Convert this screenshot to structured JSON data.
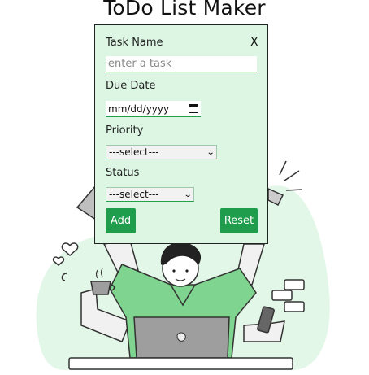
{
  "app": {
    "title": "ToDo List Maker"
  },
  "modal": {
    "close_label": "X",
    "task_name": {
      "label": "Task Name",
      "placeholder": "enter a task",
      "value": ""
    },
    "due_date": {
      "label": "Due Date",
      "placeholder": "mm/dd/yyyy",
      "icon": "calendar-icon"
    },
    "priority": {
      "label": "Priority",
      "selected": "---select---"
    },
    "status": {
      "label": "Status",
      "selected": "---select---"
    },
    "add_label": "Add",
    "reset_label": "Reset"
  },
  "colors": {
    "modal_bg": "#dcf6e3",
    "button": "#1f9d4c",
    "blob": "#e3f7e8",
    "shirt": "#7fd48f"
  }
}
